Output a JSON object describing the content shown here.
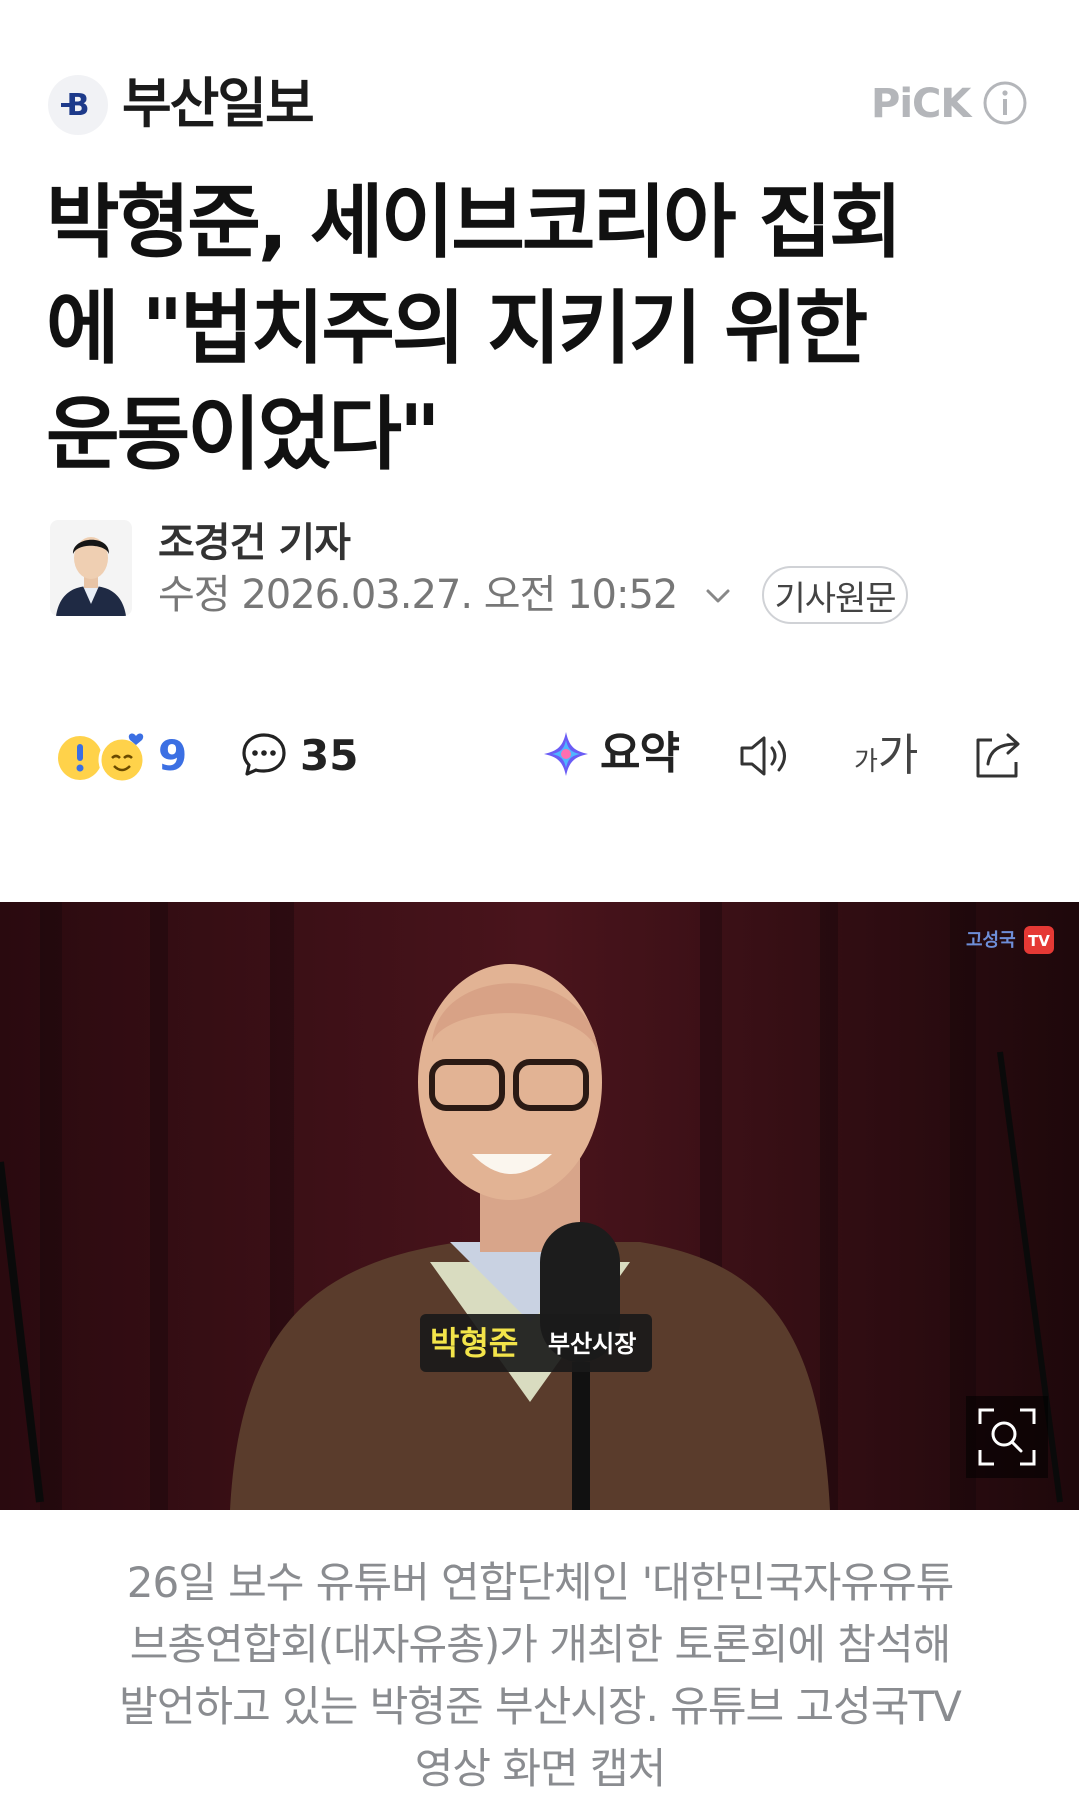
{
  "press": {
    "name": "부산일보",
    "logo_letter": "B"
  },
  "pick": {
    "label": "PiCK",
    "info_icon": "info-icon"
  },
  "article": {
    "headline_lines": [
      "박형준, 세이브코리아 집회",
      "에 \"법치주의 지키기 위한",
      "운동이었다\""
    ],
    "reporter": "조경건 기자",
    "dateline": "수정 2026.03.27. 오전 10:52",
    "original_button": "기사원문"
  },
  "toolbar": {
    "reaction_count": "9",
    "comment_count": "35",
    "summary_label": "요약",
    "font_small": "가",
    "font_large": "가",
    "icons": [
      "reaction-emoji-icon",
      "comment-icon",
      "ai-summary-icon",
      "speaker-icon",
      "font-size-icon",
      "share-icon"
    ]
  },
  "photo": {
    "subtitle_name": "박형준",
    "subtitle_title": "부산시장",
    "channel_watermark": "고성국",
    "channel_tv": "TV",
    "zoom_icon": "zoom-icon"
  },
  "caption": {
    "lines": [
      "26일 보수 유튜버 연합단체인 '대한민국자유유튜",
      "브총연합회(대자유총)가 개최한 토론회에 참석해",
      "발언하고 있는 박형준 부산시장. 유튜브 고성국TV",
      "영상 화면 캡처"
    ]
  },
  "colors": {
    "accent_blue": "#3b6fe3",
    "muted_gray": "#8a8c90",
    "curtain": "#3a1016"
  }
}
